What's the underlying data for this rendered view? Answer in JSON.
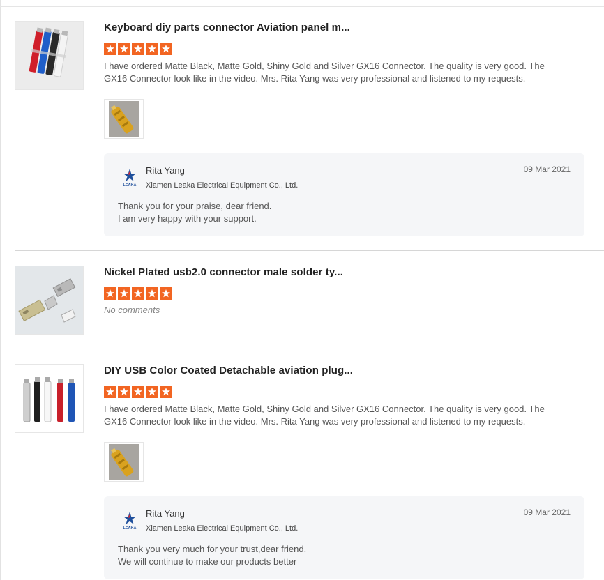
{
  "reviews": [
    {
      "title": "Keyboard diy parts connector Aviation panel m...",
      "rating": 5,
      "text": "I have ordered Matte Black, Matte Gold, Shiny Gold and Silver GX16 Connector. The quality is very good. The GX16 Connector look like in the video. Mrs. Rita Yang was very professional and listened to my requests.",
      "reply": {
        "name": "Rita Yang",
        "company": "Xiamen Leaka Electrical Equipment Co., Ltd.",
        "date": "09 Mar 2021",
        "lines": [
          "Thank you for your praise, dear friend.",
          "I am very happy with your support."
        ]
      }
    },
    {
      "title": "Nickel Plated usb2.0 connector male solder ty...",
      "rating": 5,
      "no_comments": "No comments"
    },
    {
      "title": "DIY USB Color Coated Detachable aviation plug...",
      "rating": 5,
      "text": "I have ordered Matte Black, Matte Gold, Shiny Gold and Silver GX16 Connector. The quality is very good. The GX16 Connector look like in the video. Mrs. Rita Yang was very professional and listened to my requests.",
      "reply": {
        "name": "Rita Yang",
        "company": "Xiamen Leaka Electrical Equipment Co., Ltd.",
        "date": "09 Mar 2021",
        "lines": [
          "Thank you very much for your trust,dear friend.",
          "We will continue to make our products better"
        ]
      }
    }
  ],
  "logo_text": "LEAKA",
  "colors": {
    "star": "#f26522",
    "reply_bg": "#f5f6f8",
    "logo_blue": "#1e4f9c"
  },
  "icons": {
    "star": "star-icon",
    "logo": "leaka-logo-icon"
  }
}
